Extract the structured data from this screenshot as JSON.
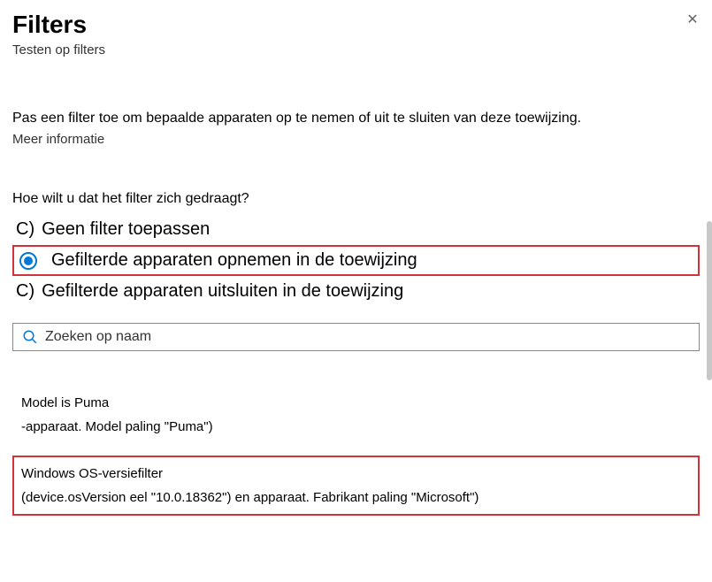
{
  "title": "Filters",
  "subtitle": "Testen op filters",
  "intro": "Pas een filter toe om bepaalde apparaten op te nemen of uit te sluiten van deze toewijzing.",
  "more_info": "Meer informatie",
  "question": "Hoe wilt u dat het filter zich gedraagt?",
  "options": {
    "none": {
      "letter": "C)",
      "label": "Geen filter toepassen"
    },
    "include": {
      "label": "Gefilterde apparaten opnemen in de toewijzing"
    },
    "exclude": {
      "letter": "C)",
      "label": "Gefilterde apparaten uitsluiten in de toewijzing"
    }
  },
  "search": {
    "placeholder": "Zoeken op naam"
  },
  "filters": [
    {
      "name": "Model is Puma",
      "expr": "-apparaat. Model paling \"Puma\")"
    },
    {
      "name": "Windows OS-versiefilter",
      "expr": "(device.osVersion eel \"10.0.18362\") en apparaat. Fabrikant paling \"Microsoft\")"
    }
  ]
}
